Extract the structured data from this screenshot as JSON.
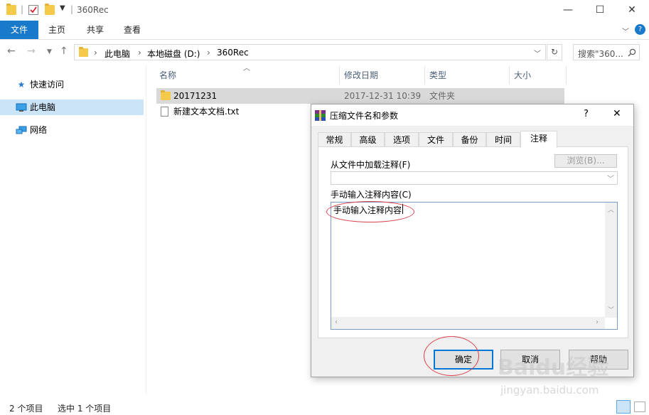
{
  "window": {
    "title": "360Rec",
    "controls": {
      "minimize": "—",
      "maximize": "☐",
      "close": "✕"
    }
  },
  "ribbon": {
    "tabs": [
      "文件",
      "主页",
      "共享",
      "查看"
    ]
  },
  "nav": {
    "breadcrumb": [
      "此电脑",
      "本地磁盘 (D:)",
      "360Rec"
    ],
    "search_placeholder": "搜索\"360...",
    "search_icon": "search-icon"
  },
  "sidebar": {
    "items": [
      {
        "label": "快速访问",
        "icon": "star-icon"
      },
      {
        "label": "此电脑",
        "icon": "computer-icon",
        "selected": true
      },
      {
        "label": "网络",
        "icon": "network-icon"
      }
    ]
  },
  "filelist": {
    "columns": [
      "名称",
      "修改日期",
      "类型",
      "大小"
    ],
    "rows": [
      {
        "name": "20171231",
        "modified": "2017-12-31 10:39",
        "type": "文件夹",
        "icon": "folder-icon",
        "selected": true
      },
      {
        "name": "新建文本文档.txt",
        "modified": "",
        "type": "",
        "icon": "text-file-icon",
        "selected": false
      }
    ]
  },
  "status": {
    "count": "2 个项目",
    "selected": "选中 1 个项目"
  },
  "dialog": {
    "title": "压缩文件名和参数",
    "help": "?",
    "close": "✕",
    "tabs": [
      "常规",
      "高级",
      "选项",
      "文件",
      "备份",
      "时间",
      "注释"
    ],
    "active_tab": "注释",
    "load_label": "从文件中加载注释(F)",
    "browse_button": "浏览(B)...",
    "manual_label": "手动输入注释内容(C)",
    "comment_text": "手动输入注释内容",
    "ok": "确定",
    "cancel": "取消",
    "help_button": "帮助"
  },
  "watermark": {
    "brand": "Baidu经验",
    "url": "jingyan.baidu.com"
  },
  "colors": {
    "accent": "#1979ca",
    "selection": "#cce4f7",
    "annotation": "#d8414a"
  }
}
